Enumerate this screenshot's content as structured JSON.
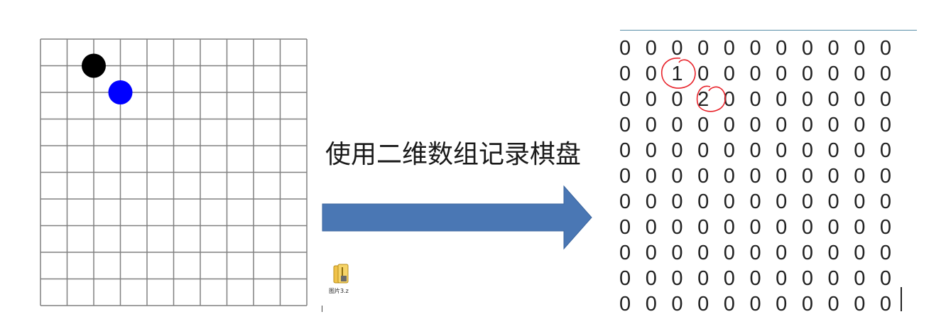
{
  "caption": "使用二维数组记录棋盘",
  "board": {
    "rows": 10,
    "cols": 10,
    "line_color": "#808080",
    "stones": [
      {
        "row": 1,
        "col": 2,
        "color": "#000000",
        "name": "black-stone"
      },
      {
        "row": 2,
        "col": 3,
        "color": "#0000ff",
        "name": "blue-stone"
      }
    ]
  },
  "arrow": {
    "color": "#4a77b4",
    "stroke": "#3b659e"
  },
  "file_icon": {
    "label": "图片3.z"
  },
  "matrix": {
    "rows": [
      [
        "0",
        "0",
        "0",
        "0",
        "0",
        "0",
        "0",
        "0",
        "0",
        "0",
        "0"
      ],
      [
        "0",
        "0",
        "1",
        "0",
        "0",
        "0",
        "0",
        "0",
        "0",
        "0",
        "0"
      ],
      [
        "0",
        "0",
        "0",
        "2",
        "0",
        "0",
        "0",
        "0",
        "0",
        "0",
        "0"
      ],
      [
        "0",
        "0",
        "0",
        "0",
        "0",
        "0",
        "0",
        "0",
        "0",
        "0",
        "0"
      ],
      [
        "0",
        "0",
        "0",
        "0",
        "0",
        "0",
        "0",
        "0",
        "0",
        "0",
        "0"
      ],
      [
        "0",
        "0",
        "0",
        "0",
        "0",
        "0",
        "0",
        "0",
        "0",
        "0",
        "0"
      ],
      [
        "0",
        "0",
        "0",
        "0",
        "0",
        "0",
        "0",
        "0",
        "0",
        "0",
        "0"
      ],
      [
        "0",
        "0",
        "0",
        "0",
        "0",
        "0",
        "0",
        "0",
        "0",
        "0",
        "0"
      ],
      [
        "0",
        "0",
        "0",
        "0",
        "0",
        "0",
        "0",
        "0",
        "0",
        "0",
        "0"
      ],
      [
        "0",
        "0",
        "0",
        "0",
        "0",
        "0",
        "0",
        "0",
        "0",
        "0",
        "0"
      ],
      [
        "0",
        "0",
        "0",
        "0",
        "0",
        "0",
        "0",
        "0",
        "0",
        "0",
        "0"
      ]
    ],
    "highlight_color": "#e8232b"
  }
}
